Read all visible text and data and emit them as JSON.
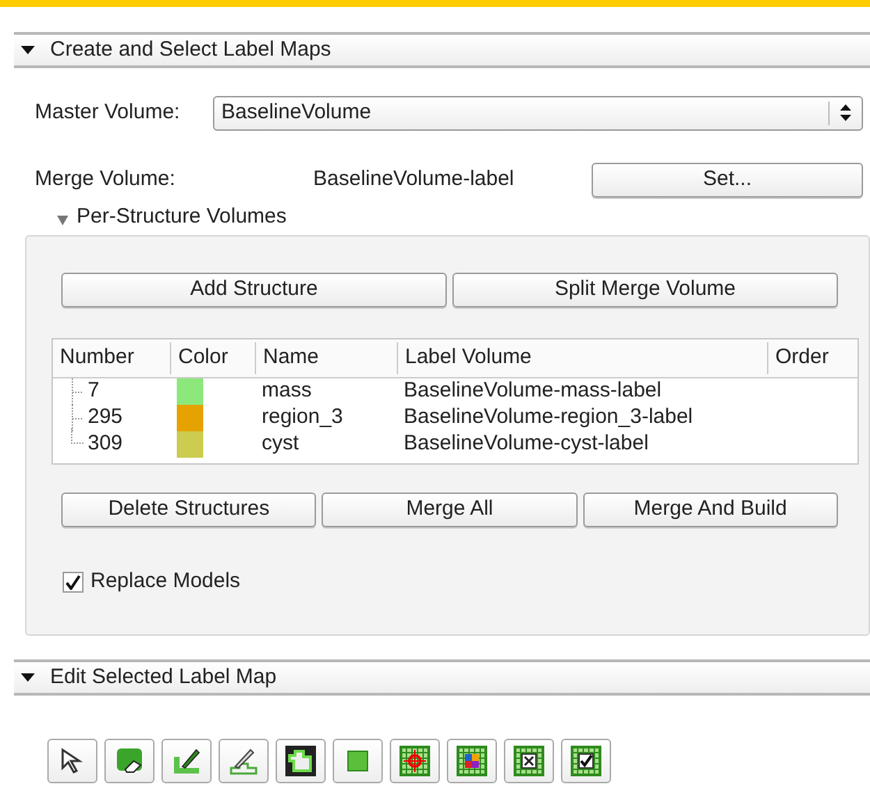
{
  "sections": [
    {
      "title": "Create and Select Label Maps",
      "expanded": true
    },
    {
      "title": "Edit Selected Label Map",
      "expanded": true
    }
  ],
  "master_volume": {
    "label": "Master Volume:",
    "value": "BaselineVolume"
  },
  "merge_volume": {
    "label": "Merge Volume:",
    "value": "BaselineVolume-label",
    "button": "Set..."
  },
  "per_structure": {
    "title": "Per-Structure Volumes",
    "expanded": true,
    "top_buttons": [
      "Add Structure",
      "Split Merge Volume"
    ],
    "table": {
      "columns": [
        "Number",
        "Color",
        "Name",
        "Label Volume",
        "Order"
      ],
      "rows": [
        {
          "number": "7",
          "color": "#8ce87a",
          "name": "mass",
          "label_volume": "BaselineVolume-mass-label"
        },
        {
          "number": "295",
          "color": "#e6a200",
          "name": "region_3",
          "label_volume": "BaselineVolume-region_3-label"
        },
        {
          "number": "309",
          "color": "#cccc50",
          "name": "cyst",
          "label_volume": "BaselineVolume-cyst-label"
        }
      ]
    },
    "bottom_buttons": [
      "Delete Structures",
      "Merge All",
      "Merge And Build"
    ],
    "replace_models": {
      "label": "Replace Models",
      "checked": true
    }
  },
  "tools": [
    {
      "kind": "pointer"
    },
    {
      "kind": "erase"
    },
    {
      "kind": "paint"
    },
    {
      "kind": "draw"
    },
    {
      "kind": "outline"
    },
    {
      "kind": "square"
    },
    {
      "kind": "target"
    },
    {
      "kind": "palette"
    },
    {
      "kind": "cross"
    },
    {
      "kind": "check"
    }
  ]
}
